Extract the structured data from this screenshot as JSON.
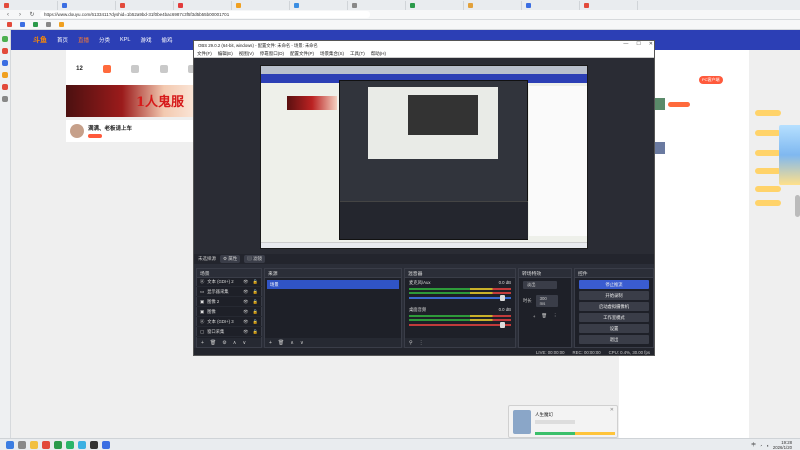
{
  "browser": {
    "tabs": [
      {
        "label": "",
        "color": "#e24a3b"
      },
      {
        "label": "",
        "color": "#3b6ee2"
      },
      {
        "label": "",
        "color": "#e24a3b"
      },
      {
        "label": "",
        "color": "#e23b3b"
      },
      {
        "label": "",
        "color": "#f0a020"
      },
      {
        "label": "",
        "color": "#3b8ee2"
      },
      {
        "label": "",
        "color": "#888888"
      },
      {
        "label": "",
        "color": "#2b9a4a"
      },
      {
        "label": "",
        "color": "#e2a13b"
      },
      {
        "label": "",
        "color": "#3b6ee2"
      },
      {
        "label": "",
        "color": "#e24a3b"
      }
    ],
    "url": "https://www.douyu.com/6133411?dyshid=1b52a9bd-31f0be4bac6987c3f5f3d5b55b00001701"
  },
  "page": {
    "site_nav": [
      "首页",
      "直播",
      "分类",
      "KPL",
      "游戏",
      "偷鸡"
    ],
    "room_stats": [
      {
        "label": "12"
      },
      {
        "label": ""
      },
      {
        "label": ""
      },
      {
        "label": ""
      },
      {
        "label": ""
      }
    ],
    "banner_text": "1人鬼服",
    "anchor_name": "满满、老板请上车",
    "anchor_tag": "",
    "right_badge": "PC客户端",
    "chat_text": [
      "",
      "",
      "",
      "",
      "",
      "",
      "",
      "",
      "",
      "",
      "",
      "",
      ""
    ]
  },
  "obs": {
    "title": "OBS 29.0.2 (64-bit, windows) - 配置文件: 未命名 - 场景: 未命名",
    "menu": [
      "文件(F)",
      "编辑(E)",
      "视图(V)",
      "停靠窗口(D)",
      "配置文件(P)",
      "场景集合(S)",
      "工具(T)",
      "帮助(H)"
    ],
    "bar_left": "未选择源",
    "bar_props": "属性",
    "bar_filters": "滤镜",
    "docks": {
      "scenes_title": "场景",
      "sources_title": "来源",
      "mixer_title": "混音器",
      "transitions_title": "转场特效",
      "controls_title": "控件"
    },
    "scenes": [
      "场景"
    ],
    "sources": [
      {
        "label": "文本 (GDI+) 2"
      },
      {
        "label": "显示器采集"
      },
      {
        "label": "图像 2"
      },
      {
        "label": "图像"
      },
      {
        "label": "文本 (GDI+) 3"
      },
      {
        "label": "窗口采集"
      }
    ],
    "mixer": [
      {
        "name": "麦克风/Aux",
        "db": "0.0 dB"
      },
      {
        "name": "桌面音频",
        "db": "0.0 dB"
      }
    ],
    "transitions": {
      "type_label": "",
      "type_value": "淡出",
      "duration_label": "时长",
      "duration_value": "300 ms"
    },
    "controls": [
      "停止推流",
      "开始录制",
      "启动虚拟摄像机",
      "工作室模式",
      "设置",
      "退出"
    ],
    "status": {
      "live": "LIVE: 00:00:00",
      "rec": "REC: 00:00:00",
      "cpu": "CPU: 0.4%, 30.00 fps"
    }
  },
  "popup": {
    "title": "人生魔幻",
    "subtitle": ""
  },
  "taskbar": {
    "clock_time": "19:28",
    "clock_date": "2026/1/20",
    "ime": "中"
  }
}
